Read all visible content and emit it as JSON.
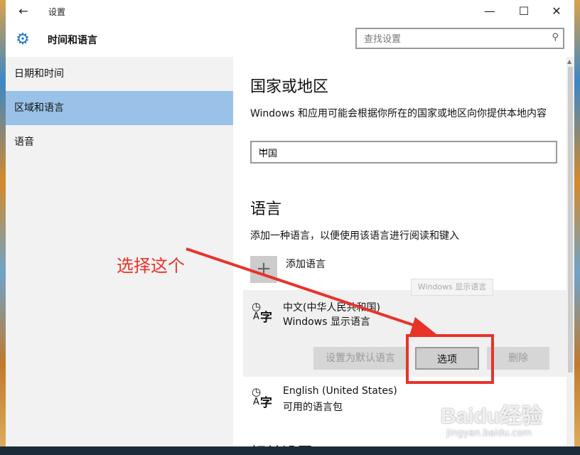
{
  "window": {
    "title": "设置",
    "controls": {
      "minimize": "—",
      "maximize": "☐",
      "close": "✕"
    }
  },
  "header": {
    "title": "时间和语言",
    "search_placeholder": "查找设置"
  },
  "sidebar": {
    "items": [
      {
        "label": "日期和时间",
        "active": false
      },
      {
        "label": "区域和语言",
        "active": true
      },
      {
        "label": "语音",
        "active": false
      }
    ]
  },
  "region": {
    "heading": "国家或地区",
    "description": "Windows 和应用可能会根据你所在的国家或地区向你提供本地内容",
    "selected": "中国"
  },
  "language": {
    "heading": "语言",
    "description": "添加一种语言，以便使用该语言进行阅读和键入",
    "add_label": "添加语言",
    "tooltip": "Windows 显示语言",
    "items": [
      {
        "name": "中文(中华人民共和国)",
        "status": "Windows 显示语言"
      },
      {
        "name": "English (United States)",
        "status": "可用的语言包"
      }
    ],
    "buttons": {
      "set_default": "设置为默认语言",
      "options": "选项",
      "remove": "删除"
    }
  },
  "related": {
    "heading": "相关设置"
  },
  "annotation": {
    "text": "选择这个",
    "color": "#e8332a"
  },
  "watermark": {
    "logo": "Baidu经验",
    "url": "jingyan.baidu.com"
  },
  "colors": {
    "accent": "#1a73c8",
    "selected_nav": "#9ac2e8"
  }
}
